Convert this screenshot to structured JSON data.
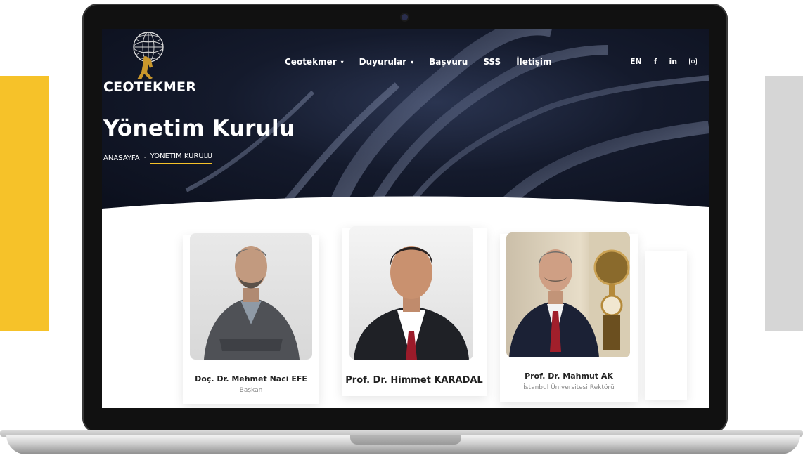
{
  "brand": {
    "name": "CEOTEKMER"
  },
  "nav": {
    "items": [
      {
        "label": "Ceotekmer",
        "dropdown": true
      },
      {
        "label": "Duyurular",
        "dropdown": true
      },
      {
        "label": "Başvuru",
        "dropdown": false
      },
      {
        "label": "SSS",
        "dropdown": false
      },
      {
        "label": "İletişim",
        "dropdown": false
      }
    ],
    "caret": "▾",
    "language": "EN",
    "social": [
      "facebook-icon",
      "linkedin-icon",
      "instagram-icon"
    ],
    "facebook_glyph": "f",
    "linkedin_glyph": "in"
  },
  "page": {
    "title": "Yönetim Kurulu",
    "breadcrumb": {
      "home": "ANASAYFA",
      "separator": "·",
      "current": "YÖNETİM KURULU"
    }
  },
  "members": [
    {
      "name": "Doç. Dr. Mehmet Naci EFE",
      "role": "Başkan"
    },
    {
      "name": "Prof. Dr. Himmet KARADAL",
      "role": ""
    },
    {
      "name": "Prof. Dr. Mahmut AK",
      "role": "İstanbul Üniversitesi Rektörü"
    }
  ],
  "colors": {
    "accent": "#f6c229",
    "hero_bg": "#0b0f1c",
    "side_gray": "#d6d6d6"
  }
}
